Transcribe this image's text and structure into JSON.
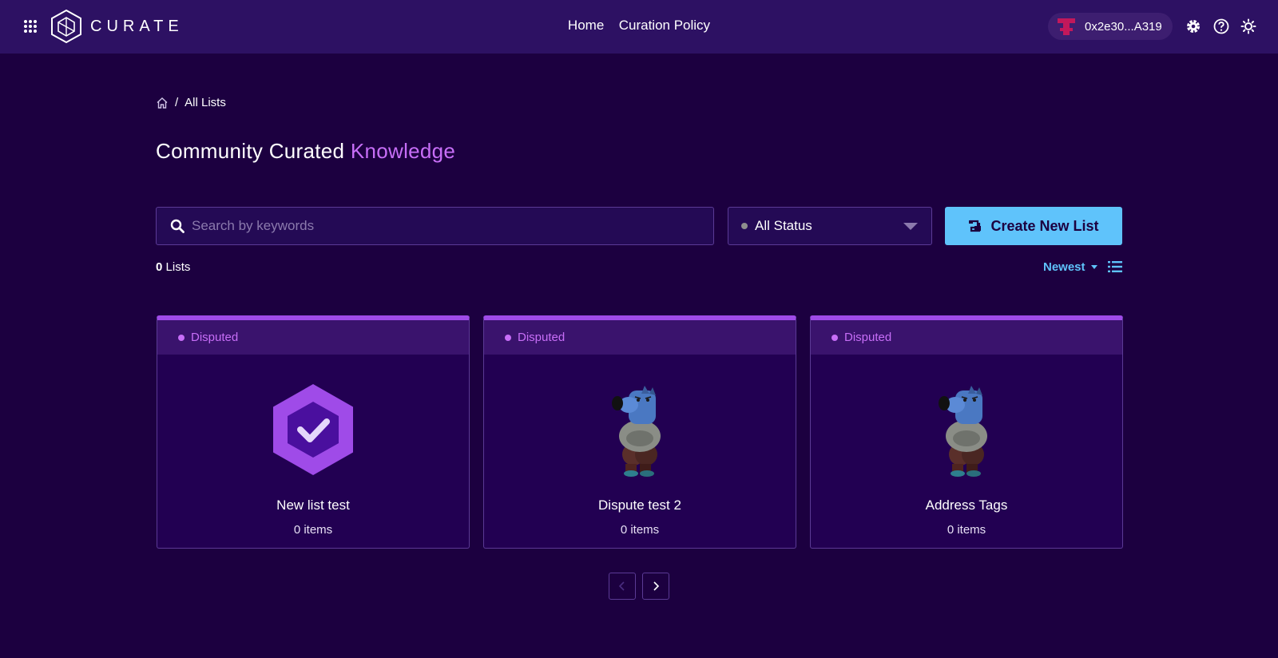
{
  "header": {
    "brand": "CURATE",
    "nav": [
      {
        "label": "Home"
      },
      {
        "label": "Curation Policy"
      }
    ],
    "wallet": {
      "address": "0x2e30...A319"
    }
  },
  "breadcrumb": {
    "current": "All Lists"
  },
  "title": {
    "main": "Community Curated",
    "accent": "Knowledge"
  },
  "search": {
    "placeholder": "Search by keywords",
    "value": ""
  },
  "status_filter": {
    "selected": "All Status"
  },
  "create_button": {
    "label": "Create New List"
  },
  "list_count": {
    "number": "0",
    "suffix": "Lists"
  },
  "sort": {
    "selected": "Newest"
  },
  "cards": [
    {
      "status": "Disputed",
      "name": "New list test",
      "items": "0 items",
      "image": "kleros-check-hexagon"
    },
    {
      "status": "Disputed",
      "name": "Dispute test 2",
      "items": "0 items",
      "image": "blue-dog-character"
    },
    {
      "status": "Disputed",
      "name": "Address Tags",
      "items": "0 items",
      "image": "blue-dog-character"
    }
  ],
  "colors": {
    "background": "#1c0040",
    "header": "#2d1163",
    "accent_purple": "#c76ef7",
    "accent_blue": "#5fc3fb"
  }
}
